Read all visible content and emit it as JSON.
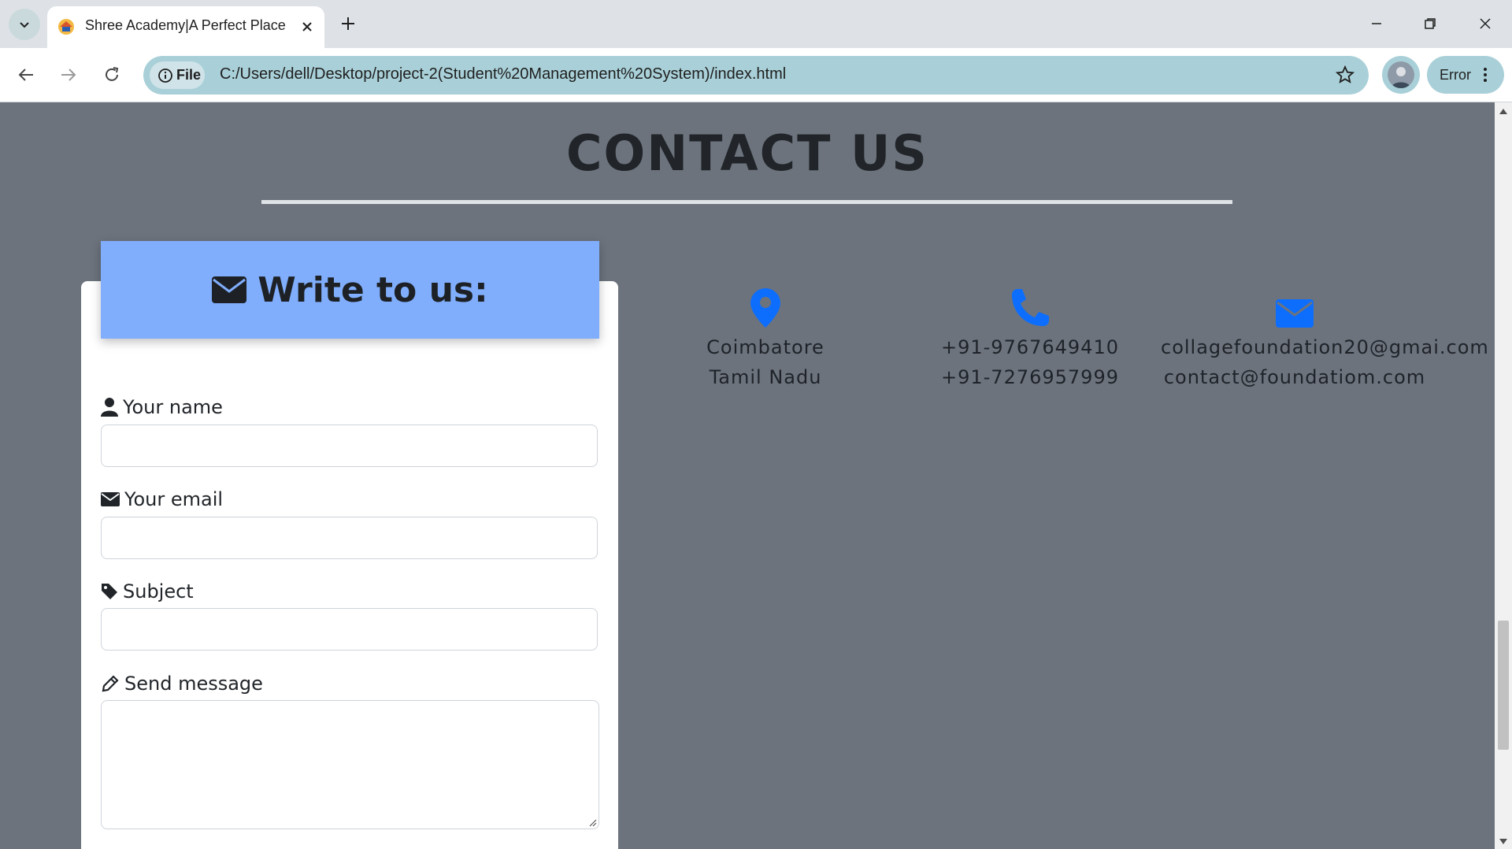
{
  "browser": {
    "tab_title": "Shree Academy|A Perfect Place",
    "file_chip_label": "File",
    "url": "C:/Users/dell/Desktop/project-2(Student%20Management%20System)/index.html",
    "error_label": "Error"
  },
  "page": {
    "heading": "CONTACT US",
    "form": {
      "header_title": "Write to us:",
      "name_label": "Your name",
      "email_label": "Your email",
      "subject_label": "Subject",
      "message_label": "Send message",
      "name_value": "",
      "email_value": "",
      "subject_value": "",
      "message_value": ""
    },
    "contact_info": {
      "location": {
        "icon": "map-pin-icon",
        "line1": "Coimbatore",
        "line2": "Tamil Nadu"
      },
      "phone": {
        "icon": "phone-icon",
        "line1": "+91-9767649410",
        "line2": "+91-7276957999"
      },
      "email": {
        "icon": "envelope-icon",
        "line1": "collagefoundation20@gmai.com",
        "line2": "contact@foundatiom.com"
      }
    }
  },
  "colors": {
    "page_background": "#6c737d",
    "form_header": "#80aefc",
    "icon_accent": "#0d6efd",
    "omnibox": "#a9d0d8"
  }
}
